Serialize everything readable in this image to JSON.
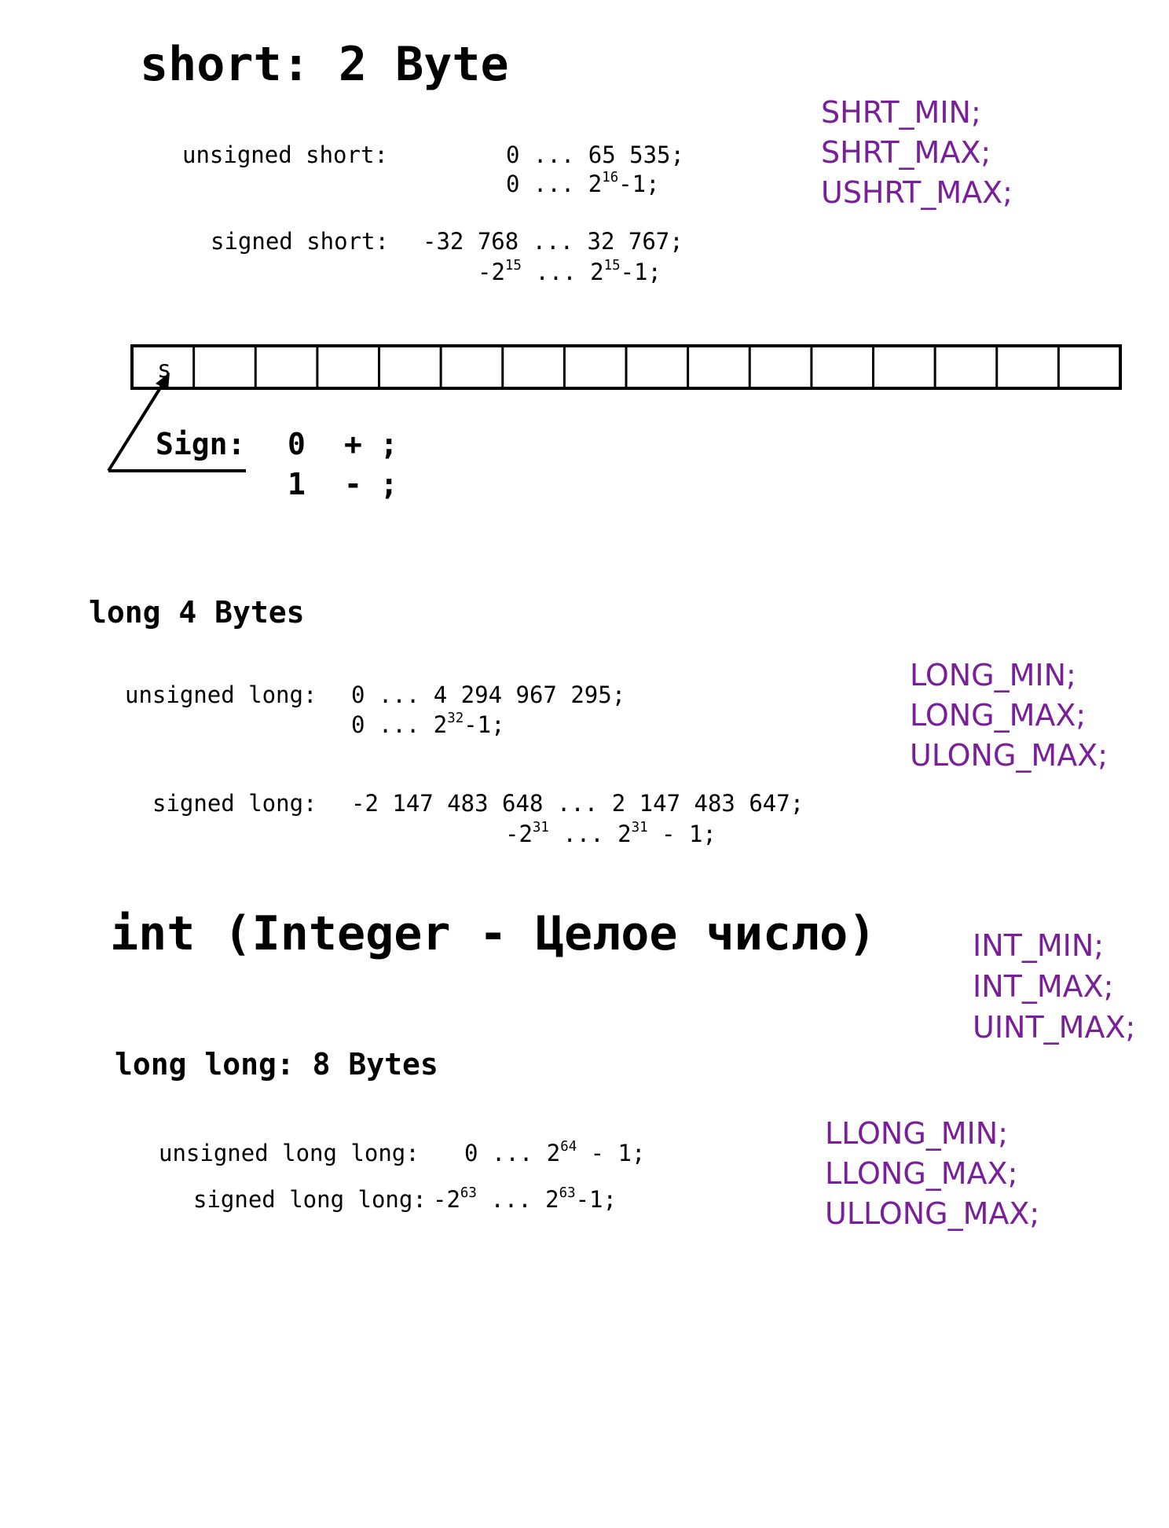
{
  "short_section": {
    "title": "short: 2 Byte",
    "unsigned_label": "unsigned short:",
    "unsigned_range": "0 ... 65 535;",
    "unsigned_pow_prefix": "0 ... 2",
    "unsigned_pow_exp": "16",
    "unsigned_pow_suffix": "-1;",
    "signed_label": "signed short:",
    "signed_range": "-32 768 ... 32 767;",
    "signed_pow_a": "-2",
    "signed_pow_a_exp": "15",
    "signed_pow_mid": " ... 2",
    "signed_pow_b_exp": "15",
    "signed_pow_suffix": "-1;",
    "macros": [
      "SHRT_MIN;",
      "SHRT_MAX;",
      "USHRT_MAX;"
    ]
  },
  "bit_diagram": {
    "sign_bit_label": "s",
    "cell_count": 16,
    "sign_label": "Sign:",
    "sign_rows": [
      {
        "bit": "0",
        "meaning": "+ ;"
      },
      {
        "bit": "1",
        "meaning": "- ;"
      }
    ]
  },
  "long_section": {
    "title": "long 4 Bytes",
    "unsigned_label": "unsigned long:",
    "unsigned_range": "0 ... 4 294 967 295;",
    "unsigned_pow_prefix": "0 ... 2",
    "unsigned_pow_exp": "32",
    "unsigned_pow_suffix": "-1;",
    "signed_label": "signed long:",
    "signed_range": "-2 147 483 648 ... 2 147 483 647;",
    "signed_pow_a": "-2",
    "signed_pow_a_exp": "31",
    "signed_pow_mid": " ... 2",
    "signed_pow_b_exp": "31",
    "signed_pow_suffix": " - 1;",
    "macros": [
      "LONG_MIN;",
      "LONG_MAX;",
      "ULONG_MAX;"
    ]
  },
  "int_section": {
    "title": "int (Integer - Целое число)",
    "macros": [
      "INT_MIN;",
      "INT_MAX;",
      "UINT_MAX;"
    ]
  },
  "long_long_section": {
    "title": "long long: 8 Bytes",
    "unsigned_label": "unsigned long long:",
    "unsigned_pow_prefix": "0 ... 2",
    "unsigned_pow_exp": "64",
    "unsigned_pow_suffix": " - 1;",
    "signed_label": "signed long long:",
    "signed_pow_a": "-2",
    "signed_pow_a_exp": "63",
    "signed_pow_mid": " ... 2",
    "signed_pow_b_exp": "63",
    "signed_pow_suffix": "-1;",
    "macros": [
      "LLONG_MIN;",
      "LLONG_MAX;",
      "ULLONG_MAX;"
    ]
  },
  "colors": {
    "macro": "#7a1f9a",
    "text": "#000000",
    "background": "#ffffff"
  }
}
